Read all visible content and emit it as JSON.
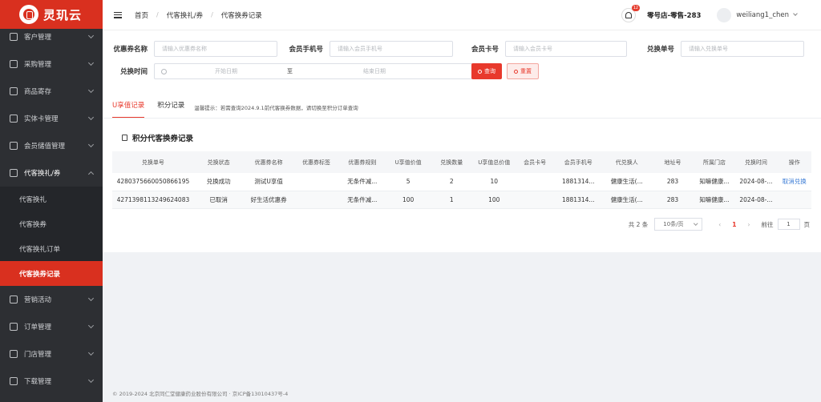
{
  "brand": {
    "name": "灵玑云"
  },
  "sidebar": {
    "items_top": [
      {
        "label": "客户管理",
        "icon": "user-file-icon"
      },
      {
        "label": "采购管理",
        "icon": "purchase-icon"
      },
      {
        "label": "商品寄存",
        "icon": "box-icon"
      },
      {
        "label": "实体卡管理",
        "icon": "book-icon"
      },
      {
        "label": "会员储值管理",
        "icon": "members-icon"
      },
      {
        "label": "代客换礼/券",
        "icon": "cart-icon"
      }
    ],
    "sub_items": [
      {
        "label": "代客换礼"
      },
      {
        "label": "代客换券"
      },
      {
        "label": "代客换礼订单"
      },
      {
        "label": "代客换券记录"
      }
    ],
    "items_bottom": [
      {
        "label": "营销活动",
        "icon": "gift-icon"
      },
      {
        "label": "订单管理",
        "icon": "grid-icon"
      },
      {
        "label": "门店管理",
        "icon": "store-icon"
      },
      {
        "label": "下载管理",
        "icon": "download-icon"
      }
    ]
  },
  "header": {
    "breadcrumb": [
      "首页",
      "代客换礼/券",
      "代客换券记录"
    ],
    "notification_count": "12",
    "store_name": "零号店-零售-283",
    "username": "weiliang1_chen"
  },
  "filters": {
    "coupon_name": {
      "label": "优惠券名称",
      "placeholder": "请输入优惠券名称"
    },
    "phone": {
      "label": "会员手机号",
      "placeholder": "请输入会员手机号"
    },
    "card_no": {
      "label": "会员卡号",
      "placeholder": "请输入会员卡号"
    },
    "exchange_no": {
      "label": "兑换单号",
      "placeholder": "请输入兑换单号"
    },
    "exchange_time": {
      "label": "兑换时间",
      "start": "开始日期",
      "to": "至",
      "end": "结束日期"
    },
    "query_label": "查询",
    "reset_label": "重置"
  },
  "tabs": [
    {
      "label": "U享值记录"
    },
    {
      "label": "积分记录"
    }
  ],
  "tab_hint": "温馨提示：若需查询2024.9.1前代客换券数据，请切换至积分订单查询",
  "section_title": "积分代客换券记录",
  "table": {
    "columns": [
      "兑换单号",
      "兑换状态",
      "优惠券名称",
      "优惠券标签",
      "优惠券规则",
      "U享值价值",
      "兑换数量",
      "U享值总价值",
      "会员卡号",
      "会员手机号",
      "代兑换人",
      "地址号",
      "所属门店",
      "兑换时间",
      "操作"
    ],
    "rows": [
      [
        "4280375660050866195",
        "兑换成功",
        "测试U享值",
        "",
        "无条件减...",
        "5",
        "2",
        "10",
        "",
        "1881314...",
        "健康生活(...",
        "283",
        "知嘛健康...",
        "2024-08-...",
        "取消兑换"
      ],
      [
        "4271398113249624083",
        "已取消",
        "好生活优惠券",
        "",
        "无条件减...",
        "100",
        "1",
        "100",
        "",
        "1881314...",
        "健康生活(...",
        "283",
        "知嘛健康...",
        "2024-08-...",
        ""
      ]
    ]
  },
  "pagination": {
    "total": "共 2 条",
    "page_size": "10条/页",
    "current": "1",
    "goto_label": "前往",
    "goto_value": "1",
    "page_suffix": "页"
  },
  "footer": {
    "text": "© 2019-2024 北京同仁堂健康药业股份有限公司 · 京ICP备13010437号-4"
  },
  "colors": {
    "brand_red": "#d9301f",
    "sidebar_bg": "#2d2f33",
    "link_blue": "#3a7bd5"
  }
}
